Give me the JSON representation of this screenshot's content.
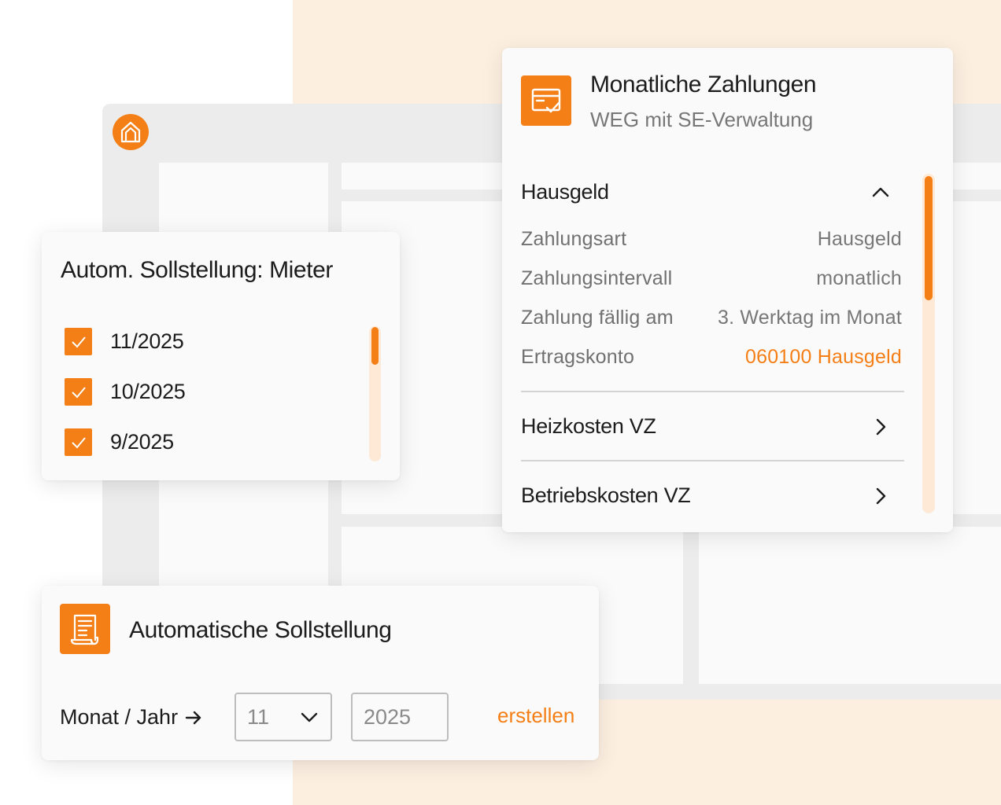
{
  "colors": {
    "accent": "#f47f16",
    "peach_background": "#fdefe0",
    "window_gray": "#ececec"
  },
  "app": {
    "logo_icon": "house-icon"
  },
  "mieter_card": {
    "title": "Autom. Sollstellung: Mieter",
    "periods": [
      {
        "label": "11/2025",
        "checked": true
      },
      {
        "label": "10/2025",
        "checked": true
      },
      {
        "label": "9/2025",
        "checked": true
      }
    ]
  },
  "zahlungen_card": {
    "icon": "payment-card-check-icon",
    "title": "Monatliche Zahlungen",
    "subtitle": "WEG mit SE-Verwaltung",
    "sections": [
      {
        "title": "Hausgeld",
        "expanded": true,
        "rows": [
          {
            "label": "Zahlungsart",
            "value": "Hausgeld"
          },
          {
            "label": "Zahlungsintervall",
            "value": "monatlich"
          },
          {
            "label": "Zahlung fällig am",
            "value": "3. Werktag im Monat"
          },
          {
            "label": "Ertragskonto",
            "value": "060100 Hausgeld"
          }
        ]
      },
      {
        "title": "Heizkosten VZ",
        "expanded": false
      },
      {
        "title": "Betriebskosten VZ",
        "expanded": false
      }
    ]
  },
  "auto_card": {
    "icon": "receipt-icon",
    "title": "Automatische Sollstellung",
    "label": "Monat / Jahr",
    "month_value": "11",
    "year_value": "2025",
    "create_label": "erstellen"
  }
}
